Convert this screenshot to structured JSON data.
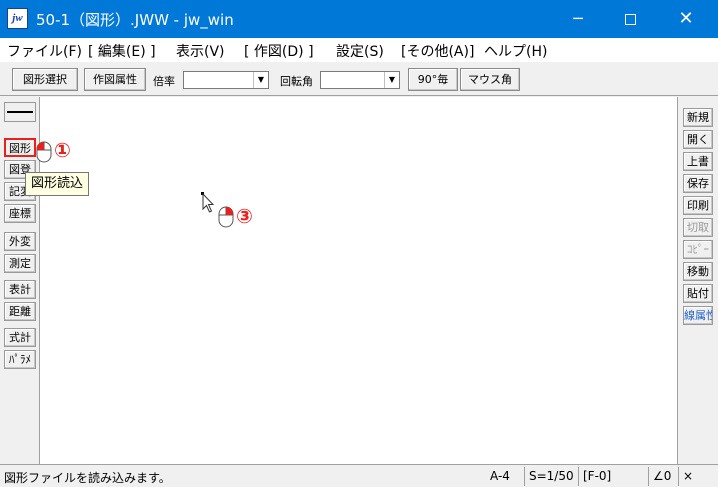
{
  "window": {
    "icon_label": "jw",
    "title": "50-1（図形）.JWW - jw_win",
    "minimize_glyph": "─",
    "close_glyph": "✕"
  },
  "menu": {
    "items": [
      "ファイル(F)",
      "[ 編集(E) ]",
      "表示(V)",
      "[ 作図(D) ]",
      "設定(S)",
      "[その他(A)]",
      "ヘルプ(H)"
    ]
  },
  "toolbar": {
    "figure_select": "図形選択",
    "draw_attr": "作図属性",
    "scale_label": "倍率",
    "scale_value": "",
    "rotation_label": "回転角",
    "rotation_value": "",
    "angle_90": "90°毎",
    "mouse_angle": "マウス角"
  },
  "left_tools": [
    {
      "name": "zukei",
      "label": "図形",
      "selected": true
    },
    {
      "name": "zutou",
      "label": "図登"
    },
    {
      "name": "kitou",
      "label": "記変"
    },
    {
      "name": "zahyou",
      "label": "座標"
    },
    {
      "name": "gaihen",
      "label": "外変"
    },
    {
      "name": "sokutei",
      "label": "測定"
    },
    {
      "name": "hyoukei",
      "label": "表計"
    },
    {
      "name": "kyori",
      "label": "距離"
    },
    {
      "name": "shikikei",
      "label": "式計"
    },
    {
      "name": "parame",
      "label": "ﾊﾟﾗﾒ"
    }
  ],
  "right_tools": [
    {
      "name": "shinki",
      "label": "新規",
      "state": "normal"
    },
    {
      "name": "hiraku",
      "label": "開く",
      "state": "normal"
    },
    {
      "name": "uwagaki",
      "label": "上書",
      "state": "normal"
    },
    {
      "name": "hozon",
      "label": "保存",
      "state": "normal"
    },
    {
      "name": "insatsu",
      "label": "印刷",
      "state": "normal"
    },
    {
      "name": "kiritori",
      "label": "切取",
      "state": "disabled"
    },
    {
      "name": "copy",
      "label": "ｺﾋﾟｰ",
      "state": "disabled"
    },
    {
      "name": "idou",
      "label": "移動",
      "state": "normal"
    },
    {
      "name": "haritsuke",
      "label": "貼付",
      "state": "normal"
    },
    {
      "name": "senzokusei",
      "label": "線属性",
      "state": "blue"
    }
  ],
  "tooltip": "図形読込",
  "annotations": {
    "step1": "①",
    "step3": "③"
  },
  "status": {
    "message": "図形ファイルを読み込みます。",
    "paper": "A-4",
    "scale": "S=1/50",
    "layer": "[F-0]",
    "angle": "∠0",
    "flag": "×"
  },
  "colors": {
    "titlebar": "#0078d7",
    "highlight": "#e8201e",
    "tooltip_bg": "#ffffe1"
  }
}
